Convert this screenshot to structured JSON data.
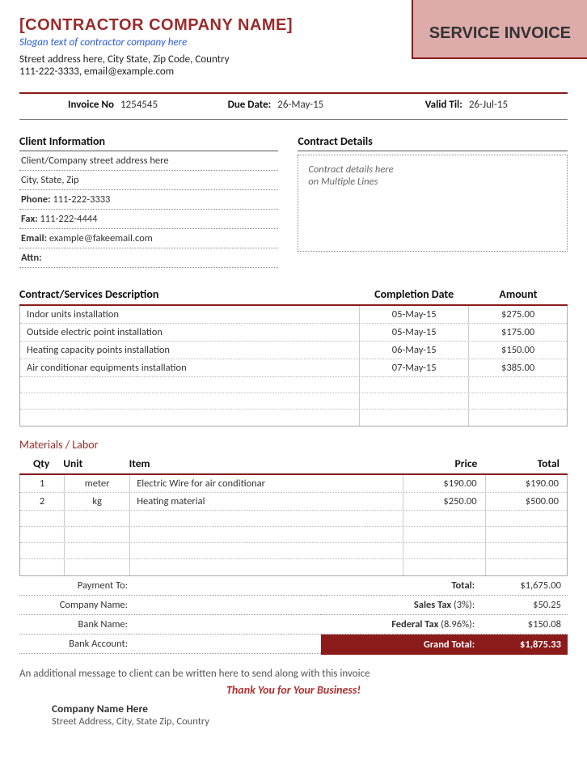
{
  "header": {
    "company_name": "[CONTRACTOR COMPANY NAME]",
    "slogan": "Slogan text of contractor company here",
    "address": "Street address here, City State, Zip Code, Country",
    "phone_email": "111-222-3333, email@example.com",
    "badge": "SERVICE INVOICE"
  },
  "meta": {
    "invoice_no_label": "Invoice No",
    "invoice_no": "1254545",
    "due_label": "Due Date:",
    "due_date": "26-May-15",
    "valid_label": "Valid Til:",
    "valid_til": "26-Jul-15"
  },
  "client": {
    "heading": "Client Information",
    "rows": [
      {
        "label": "",
        "value": "Client/Company street address here"
      },
      {
        "label": "",
        "value": "City, State, Zip"
      },
      {
        "label": "Phone:",
        "value": "111-222-3333"
      },
      {
        "label": "Fax:",
        "value": "111-222-4444"
      },
      {
        "label": "Email:",
        "value": "example@fakeemail.com"
      },
      {
        "label": "Attn:",
        "value": ""
      }
    ]
  },
  "contract": {
    "heading": "Contract Details",
    "body_line1": "Contract details here",
    "body_line2": "on Multiple Lines"
  },
  "services": {
    "h1": "Contract/Services Description",
    "h2": "Completion Date",
    "h3": "Amount",
    "rows": [
      {
        "desc": "Indor units installation",
        "date": "05-May-15",
        "amt": "$275.00"
      },
      {
        "desc": "Outside electric point installation",
        "date": "05-May-15",
        "amt": "$175.00"
      },
      {
        "desc": "Heating capacity points installation",
        "date": "06-May-15",
        "amt": "$150.00"
      },
      {
        "desc": "Air conditionar equipments installation",
        "date": "07-May-15",
        "amt": "$385.00"
      },
      {
        "desc": "",
        "date": "",
        "amt": ""
      },
      {
        "desc": "",
        "date": "",
        "amt": ""
      },
      {
        "desc": "",
        "date": "",
        "amt": ""
      }
    ]
  },
  "materials": {
    "title": "Materials / Labor",
    "h_qty": "Qty",
    "h_unit": "Unit",
    "h_item": "Item",
    "h_price": "Price",
    "h_total": "Total",
    "rows": [
      {
        "qty": "1",
        "unit": "meter",
        "item": "Electric Wire for air conditionar",
        "price": "$190.00",
        "total": "$190.00"
      },
      {
        "qty": "2",
        "unit": "kg",
        "item": "Heating material",
        "price": "$250.00",
        "total": "$500.00"
      },
      {
        "qty": "",
        "unit": "",
        "item": "",
        "price": "",
        "total": ""
      },
      {
        "qty": "",
        "unit": "",
        "item": "",
        "price": "",
        "total": ""
      },
      {
        "qty": "",
        "unit": "",
        "item": "",
        "price": "",
        "total": ""
      },
      {
        "qty": "",
        "unit": "",
        "item": "",
        "price": "",
        "total": ""
      }
    ]
  },
  "payment": {
    "rows": [
      {
        "label": "Payment To:"
      },
      {
        "label": "Company Name:"
      },
      {
        "label": "Bank Name:"
      },
      {
        "label": "Bank Account:"
      }
    ]
  },
  "totals": {
    "rows": [
      {
        "label": "Total:",
        "pct": "",
        "value": "$1,675.00"
      },
      {
        "label": "Sales Tax",
        "pct": " (3%):",
        "value": "$50.25"
      },
      {
        "label": "Federal Tax",
        "pct": " (8.96%):",
        "value": "$150.08"
      }
    ],
    "grand_label": "Grand Total:",
    "grand_value": "$1,875.33"
  },
  "footer": {
    "msg": "An additional message to client can be written here to send along with this invoice",
    "thanks": "Thank You for Your Business!",
    "company": "Company Name Here",
    "addr": "Street Address, City, State Zip, Country"
  }
}
